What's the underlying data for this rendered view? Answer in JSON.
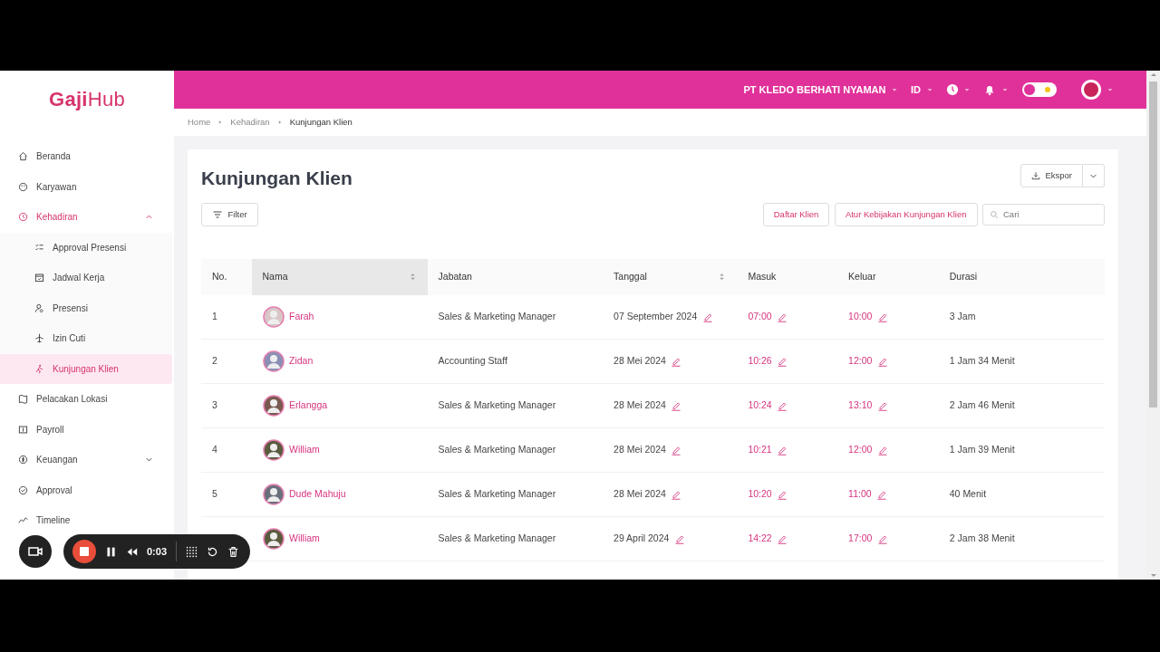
{
  "logo": "**Gaji**Hub",
  "sidebar": {
    "items": [
      {
        "label": "Beranda",
        "selected": false
      },
      {
        "label": "Karyawan",
        "selected": false
      },
      {
        "label": "Kehadiran",
        "selected": false,
        "expanded": true,
        "children": [
          {
            "label": "Approval Presensi",
            "selected": false
          },
          {
            "label": "Jadwal Kerja",
            "selected": false
          },
          {
            "label": "Presensi",
            "selected": false
          },
          {
            "label": "Izin Cuti",
            "selected": false
          },
          {
            "label": "Kunjungan Klien",
            "selected": true
          }
        ]
      },
      {
        "label": "Pelacakan Lokasi",
        "selected": false
      },
      {
        "label": "Payroll",
        "selected": false
      },
      {
        "label": "Keuangan",
        "selected": false,
        "expanded": false
      },
      {
        "label": "Approval",
        "selected": false
      },
      {
        "label": "Timeline",
        "selected": false
      }
    ]
  },
  "topbar": {
    "company": "PT KLEDO BERHATI NYAMAN",
    "language": "ID",
    "theme_toggle": {
      "on": false
    }
  },
  "breadcrumb": [
    "Home",
    "Kehadiran",
    "Kunjungan Klien"
  ],
  "page": {
    "title": "Kunjungan Klien",
    "export_button": "Ekspor",
    "filter_button": "Filter",
    "buttons": [
      "Daftar Klien",
      "Atur Kebijakan Kunjungan Klien"
    ],
    "search": {
      "placeholder": "Cari"
    }
  },
  "table": {
    "columns": [
      {
        "label": "No.",
        "sortable": false,
        "sorted": false,
        "editable": false
      },
      {
        "label": "Nama",
        "sortable": true,
        "sorted": true,
        "editable": false
      },
      {
        "label": "Jabatan",
        "sortable": false,
        "sorted": false,
        "editable": false
      },
      {
        "label": "Tanggal",
        "sortable": true,
        "sorted": false,
        "editable": true
      },
      {
        "label": "Masuk",
        "sortable": false,
        "sorted": false,
        "editable": true
      },
      {
        "label": "Keluar",
        "sortable": false,
        "sorted": false,
        "editable": true
      },
      {
        "label": "Durasi",
        "sortable": false,
        "sorted": false,
        "editable": false
      }
    ],
    "rows": [
      [
        "1",
        "Farah",
        "Sales & Marketing Manager",
        "07 September 2024",
        "07:00",
        "10:00",
        "3 Jam"
      ],
      [
        "2",
        "Zidan",
        "Accounting Staff",
        "28 Mei 2024",
        "10:26",
        "12:00",
        "1 Jam 34 Menit"
      ],
      [
        "3",
        "Erlangga",
        "Sales & Marketing Manager",
        "28 Mei 2024",
        "10:24",
        "13:10",
        "2 Jam 46 Menit"
      ],
      [
        "4",
        "William",
        "Sales & Marketing Manager",
        "28 Mei 2024",
        "10:21",
        "12:00",
        "1 Jam 39 Menit"
      ],
      [
        "5",
        "Dude Mahuju",
        "Sales & Marketing Manager",
        "28 Mei 2024",
        "10:20",
        "11:00",
        "40 Menit"
      ],
      [
        null,
        "William",
        "Sales & Marketing Manager",
        "29 April 2024",
        "14:22",
        "17:00",
        "2 Jam 38 Menit"
      ]
    ]
  },
  "recorder": {
    "time": "0:03"
  }
}
